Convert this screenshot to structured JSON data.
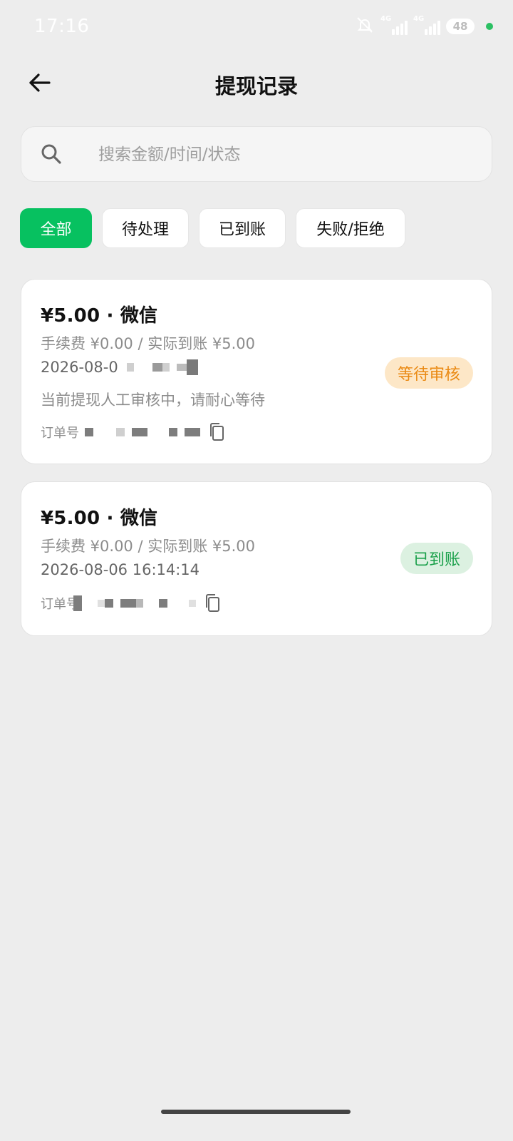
{
  "status_bar": {
    "time": "17:16",
    "network1": "4G",
    "network2": "4G",
    "battery": "48"
  },
  "header": {
    "title": "提现记录"
  },
  "search": {
    "placeholder": "搜索金额/时间/状态",
    "value": ""
  },
  "filters": [
    {
      "label": "全部",
      "active": true
    },
    {
      "label": "待处理",
      "active": false
    },
    {
      "label": "已到账",
      "active": false
    },
    {
      "label": "失败/拒绝",
      "active": false
    }
  ],
  "records": [
    {
      "amount": "¥5.00 · 微信",
      "fee": "手续费 ¥0.00 / 实际到账 ¥5.00",
      "date": "2026-08-0",
      "note": "当前提现人工审核中，请耐心等待",
      "order_label": "订单号",
      "status": "等待审核",
      "status_type": "pending"
    },
    {
      "amount": "¥5.00 · 微信",
      "fee": "手续费 ¥0.00 / 实际到账 ¥5.00",
      "date": "2026-08-06 16:14:14",
      "order_label": "订单号",
      "status": "已到账",
      "status_type": "done"
    }
  ],
  "colors": {
    "accent": "#07c160",
    "pending_text": "#ea8a14",
    "pending_bg": "#fde7c7",
    "done_text": "#1aa04a",
    "done_bg": "#dcf1e1",
    "page_bg": "#ededed"
  },
  "icons": {
    "back": "arrow-left-icon",
    "search": "search-icon",
    "copy": "copy-icon"
  }
}
